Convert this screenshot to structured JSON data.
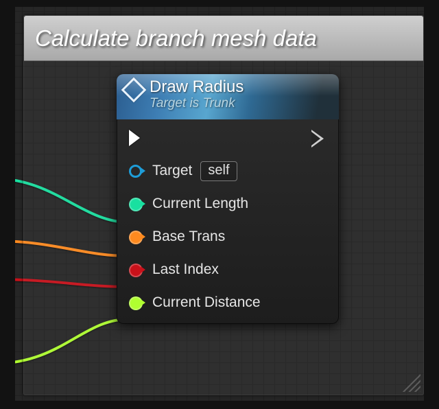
{
  "comment": {
    "title": "Calculate branch mesh data"
  },
  "node": {
    "title": "Draw Radius",
    "subtitle": "Target is Trunk",
    "target_pin_label": "Target",
    "target_default": "self",
    "pins": {
      "current_length": {
        "label": "Current Length",
        "color": "#19e0a0"
      },
      "base_trans": {
        "label": "Base Trans",
        "color": "#ff8a1f"
      },
      "last_index": {
        "label": "Last Index",
        "color": "#c9111a"
      },
      "current_dist": {
        "label": "Current Distance",
        "color": "#b0ff30"
      }
    },
    "target_pin_color": "#1e7dbf"
  }
}
